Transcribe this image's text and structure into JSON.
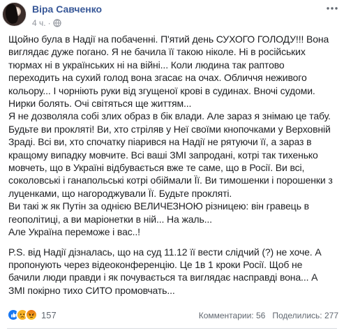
{
  "post": {
    "author": "Віра Савченко",
    "time": "4 ч.",
    "privacy_icon": "globe-icon",
    "more_icon": "more-icon",
    "lines": [
      "Щойно була в Надії на побаченні. П'ятий день СУХОГО ГОЛОДУ!!! Вона",
      "виглядає дуже погано. Я не бачила її такою ніколе. Ні в російських",
      "тюрмах ні в українських ні на війні... Коли людина так раптово",
      "переходить на сухий голод вона згасає на очах. Обличчя неживого",
      "кольору... І чорніють руки від згущеної крові в судинах. Вночі судоми.",
      "Нирки болять. Очі світяться ще життям...",
      "Я не дозволяла собі злих образ в бік влади. Але зараз я знімаю це табу.",
      "Будьте ви прокляті! Ви, хто стріляв у Неї своїми кнопочками у Верховній",
      "Зраді. Всі ви, хто спочатку піарився на Надії не рятуючи її, а зараз в",
      "кращому випадку мовчите. Всі ваші ЗМІ запродані, котрі так тихенько",
      "мовчеть, що в Україні відбувається вже те саме, що в Росії. Ви всі,",
      "соколовські і ганапольські котрі обіймали Її. Ви тимошенки і порошенки з",
      "луценками, що нагороджували Її. Будьте прокляті.",
      "Ви такі ж як Путін за однією ВЕЛИЧЕЗНОЮ різницею: він гравець в",
      "геополітиці, а ви маріонетки в ній... На жаль...",
      "Але Україна переможе і вас..!"
    ],
    "ps_lines": [
      "P.S. від Надії дізналась, що на суд 11.12 її вести слідчий (?) не хоче. А",
      "пропонують через відеоконференцію. Це 1в 1 кроки Росії. Щоб не",
      "бачили люди правди і як почувається та виглядає насправді вона... А",
      "ЗМІ покірно тихо СИТО промовчать..."
    ]
  },
  "footer": {
    "reactions": [
      "like-icon",
      "sad-icon",
      "angry-icon"
    ],
    "reaction_count": "157",
    "comments": "Комментарии: 56",
    "shares": "Поделились: 277"
  },
  "colors": {
    "link": "#385898",
    "meta": "#90949c",
    "text": "#1c1e21",
    "like": "#1877f2",
    "sad": "#f7b125",
    "angry": "#e9710f"
  }
}
